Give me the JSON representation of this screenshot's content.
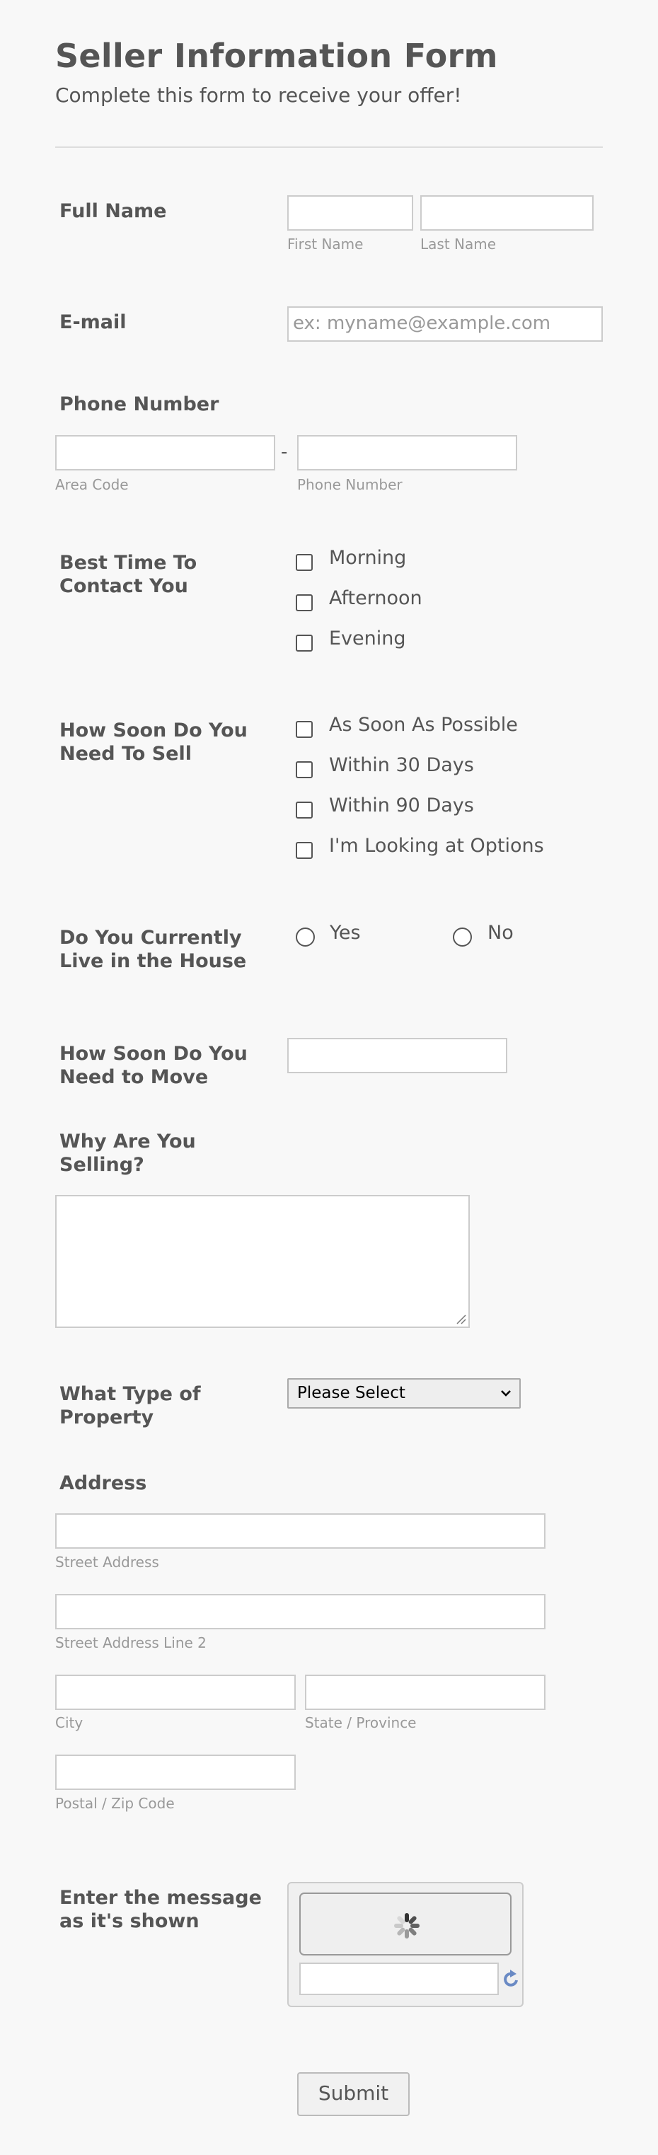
{
  "header": {
    "title": "Seller Information Form",
    "subtitle": "Complete this form to receive your offer!"
  },
  "full_name": {
    "label": "Full Name",
    "first_sublabel": "First Name",
    "last_sublabel": "Last Name",
    "first_value": "",
    "last_value": ""
  },
  "email": {
    "label": "E-mail",
    "placeholder": "ex: myname@example.com"
  },
  "phone": {
    "label": "Phone Number",
    "area_sublabel": "Area Code",
    "number_sublabel": "Phone Number",
    "separator": "-"
  },
  "contact_time": {
    "label": "Best Time To Contact You",
    "options": [
      "Morning",
      "Afternoon",
      "Evening"
    ]
  },
  "sell_timeline": {
    "label": "How Soon Do You Need To Sell",
    "options": [
      "As Soon As Possible",
      "Within 30 Days",
      "Within 90 Days",
      "I'm Looking at Options"
    ]
  },
  "live_in_house": {
    "label": "Do You Currently Live in the House",
    "options": [
      "Yes",
      "No"
    ]
  },
  "move_timeline": {
    "label": "How Soon Do You Need to Move"
  },
  "reason": {
    "label": "Why Are You Selling?"
  },
  "property_type": {
    "label": "What Type of Property",
    "selected": "Please Select"
  },
  "address": {
    "label": "Address",
    "street_sublabel": "Street Address",
    "street2_sublabel": "Street Address Line 2",
    "city_sublabel": "City",
    "state_sublabel": "State / Province",
    "postal_sublabel": "Postal / Zip Code"
  },
  "captcha": {
    "label": "Enter the message as it's shown"
  },
  "submit": {
    "label": "Submit"
  },
  "colors": {
    "text": "#555555",
    "sublabel": "#999999",
    "border": "#cccccc",
    "background": "#f8f8f8"
  }
}
